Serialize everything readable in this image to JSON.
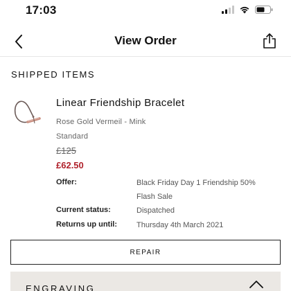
{
  "status_bar": {
    "time": "17:03",
    "icons": [
      "cellular-signal-icon",
      "wifi-icon",
      "battery-icon"
    ]
  },
  "nav": {
    "title": "View Order",
    "back_icon": "chevron-left-icon",
    "share_icon": "share-icon"
  },
  "section": {
    "heading": "SHIPPED ITEMS"
  },
  "item": {
    "name": "Linear Friendship Bracelet",
    "variant": "Rose Gold Vermeil - Mink",
    "size": "Standard",
    "original_price": "£125",
    "sale_price": "£62.50",
    "details": [
      {
        "label": "Offer:",
        "value": "Black Friday Day 1 Friendship 50% Flash Sale"
      },
      {
        "label": "Current status:",
        "value": "Dispatched"
      },
      {
        "label": "Returns up until:",
        "value": "Thursday 4th March 2021"
      }
    ]
  },
  "actions": {
    "repair_label": "REPAIR"
  },
  "engraving": {
    "label": "ENGRAVING",
    "expand_icon": "chevron-up-icon"
  },
  "colors": {
    "sale_price": "#b0212b",
    "engraving_background": "#ebe8e4",
    "bracelet_cord": "#6b5a57",
    "bracelet_bar": "#c98f80"
  }
}
